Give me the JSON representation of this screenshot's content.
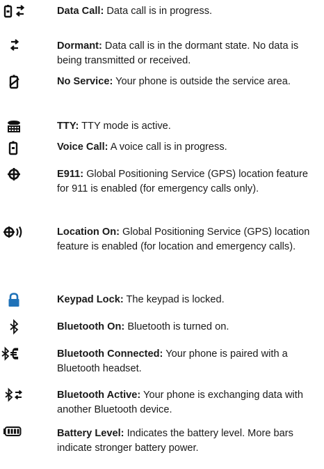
{
  "colors": {
    "icon": "#111111",
    "lock_icon": "#1f72b8",
    "text": "#1a1a1a"
  },
  "entries": [
    {
      "icon": "phone-transfer-icon",
      "term": "Data Call:",
      "desc": " Data call is in progress."
    },
    {
      "icon": "transfer-arrows-icon",
      "term": "Dormant:",
      "desc": " Data call is in the dormant state. No data is being transmitted or received."
    },
    {
      "icon": "no-service-icon",
      "term": "No Service:",
      "desc": " Your phone is outside the service area."
    },
    {
      "icon": "tty-icon",
      "term": "TTY:",
      "desc": " TTY mode is active."
    },
    {
      "icon": "voice-call-icon",
      "term": "Voice Call:",
      "desc": " A voice call is in progress."
    },
    {
      "icon": "gps-icon",
      "term": "E911:",
      "desc": " Global Positioning Service (GPS) location feature for 911 is enabled (for emergency calls only)."
    },
    {
      "icon": "location-on-icon",
      "term": "Location On:",
      "desc": " Global Positioning Service (GPS) location feature is enabled (for location and emergency calls)."
    },
    {
      "icon": "lock-icon",
      "term": "Keypad Lock:",
      "desc": " The keypad is locked."
    },
    {
      "icon": "bluetooth-icon",
      "term": "Bluetooth On:",
      "desc": " Bluetooth is turned on."
    },
    {
      "icon": "bluetooth-connected-icon",
      "term": "Bluetooth Connected:",
      "desc": " Your phone is paired with a Bluetooth headset."
    },
    {
      "icon": "bluetooth-active-icon",
      "term": "Bluetooth Active:",
      "desc": " Your phone is exchanging data with another Bluetooth device."
    },
    {
      "icon": "battery-level-icon",
      "term": "Battery Level:",
      "desc": " Indicates the battery level. More bars indicate stronger battery power."
    }
  ]
}
